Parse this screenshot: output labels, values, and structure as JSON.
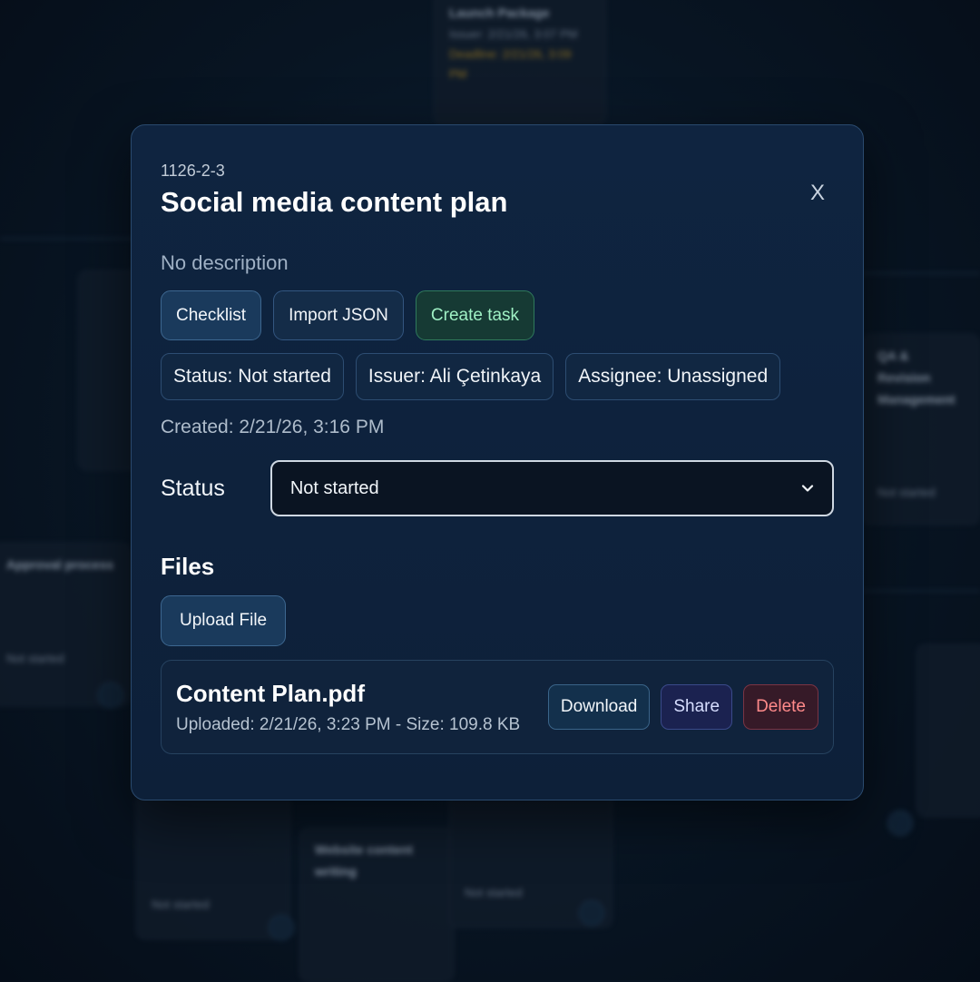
{
  "modal": {
    "task_id": "1126-2-3",
    "title": "Social media content plan",
    "close_label": "X",
    "description": "No description",
    "actions": {
      "checklist_label": "Checklist",
      "import_json_label": "Import JSON",
      "create_task_label": "Create task"
    },
    "chips": {
      "status": "Status: Not started",
      "issuer": "Issuer: Ali Çetinkaya",
      "assignee": "Assignee: Unassigned"
    },
    "created": "Created: 2/21/26, 3:16 PM",
    "status_field": {
      "label": "Status",
      "selected": "Not started"
    },
    "files": {
      "title": "Files",
      "upload_label": "Upload File",
      "items": [
        {
          "name": "Content Plan.pdf",
          "meta": "Uploaded: 2/21/26, 3:23 PM - Size: 109.8 KB",
          "download_label": "Download",
          "share_label": "Share",
          "delete_label": "Delete"
        }
      ]
    }
  },
  "background": {
    "card_top": {
      "title": "Launch Package",
      "issuer": "Issuer: 2/21/26, 3:07 PM",
      "deadline": "Deadline: 2/21/26, 3:09 PM"
    },
    "card_right": {
      "title": "QA & Revision Management",
      "status": "Not started"
    },
    "card_left": {
      "title": "Approval process",
      "status": "Not started"
    },
    "card_bottom_mid": {
      "title": "Website content writing",
      "status": "Not started"
    },
    "card_bottom_a": {
      "status": "Not started"
    },
    "card_bottom_b": {
      "status": "Not started"
    }
  },
  "colors": {
    "accent_blue": "#1a3a5c",
    "success_green": "#9ff0c4",
    "danger_red": "#ff8a8a",
    "deadline_amber": "#b58a22"
  }
}
